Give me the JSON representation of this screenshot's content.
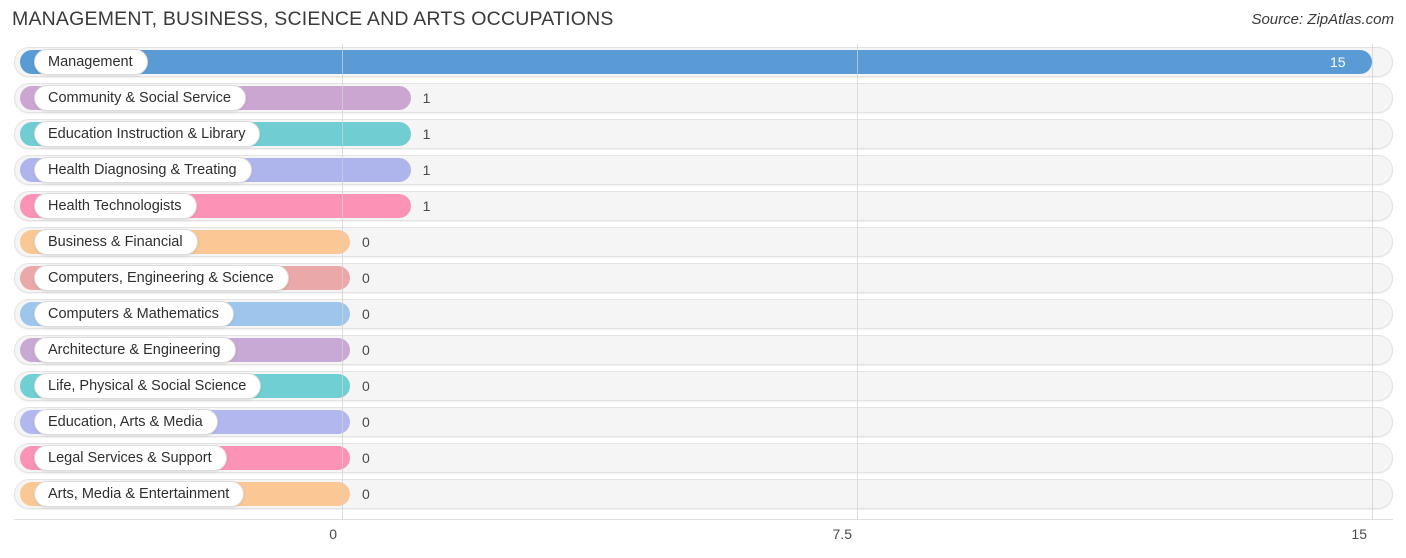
{
  "header": {
    "title": "MANAGEMENT, BUSINESS, SCIENCE AND ARTS OCCUPATIONS",
    "source": "Source: ZipAtlas.com"
  },
  "chart_data": {
    "type": "bar",
    "orientation": "horizontal",
    "title": "MANAGEMENT, BUSINESS, SCIENCE AND ARTS OCCUPATIONS",
    "xlabel": "",
    "ylabel": "",
    "xlim": [
      0,
      15
    ],
    "grid": true,
    "legend": "none",
    "xticks": [
      "0",
      "7.5",
      "15"
    ],
    "xtick_values": [
      0,
      7.5,
      15
    ],
    "categories": [
      "Management",
      "Community & Social Service",
      "Education Instruction & Library",
      "Health Diagnosing & Treating",
      "Health Technologists",
      "Business & Financial",
      "Computers, Engineering & Science",
      "Computers & Mathematics",
      "Architecture & Engineering",
      "Life, Physical & Social Science",
      "Education, Arts & Media",
      "Legal Services & Support",
      "Arts, Media & Entertainment"
    ],
    "values": [
      15,
      1,
      1,
      1,
      1,
      0,
      0,
      0,
      0,
      0,
      0,
      0,
      0
    ],
    "value_labels": [
      "15",
      "1",
      "1",
      "1",
      "1",
      "0",
      "0",
      "0",
      "0",
      "0",
      "0",
      "0",
      "0"
    ],
    "colors": [
      "#5b9bd5",
      "#cba6d1",
      "#70cdd2",
      "#aeb5ec",
      "#fa93b5",
      "#fac795",
      "#eba8a8",
      "#9ec5ec",
      "#c8a8d4",
      "#6fcfd2",
      "#b2b8ee",
      "#fa93b5",
      "#fac795"
    ]
  }
}
